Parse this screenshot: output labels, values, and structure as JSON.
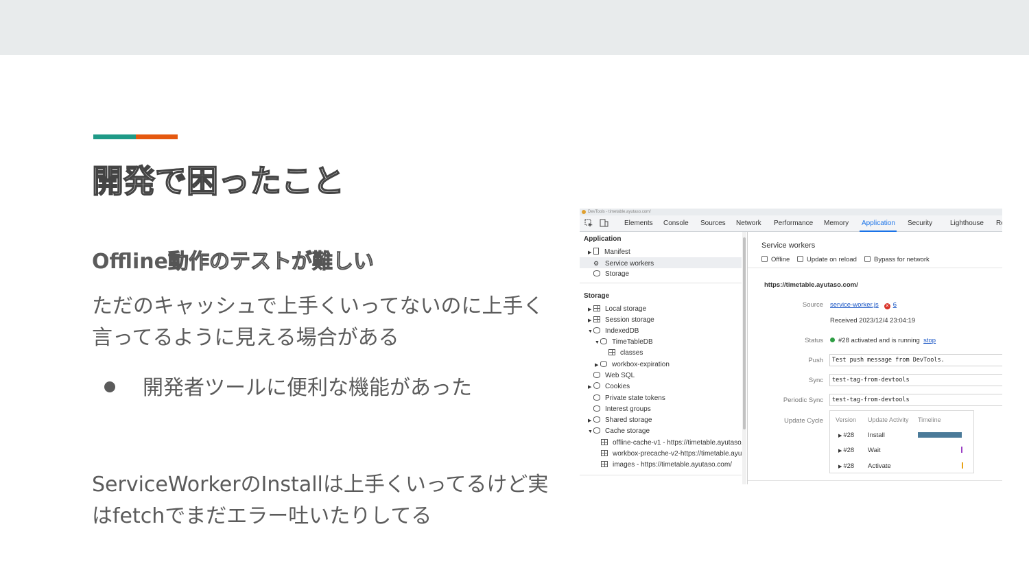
{
  "slide": {
    "title": "開発で困ったこと",
    "subheading_latin": "Offline",
    "subheading_jp": "動作のテストが難しい",
    "paragraph1": "ただのキャッシュで上手くいってないのに上手く言ってるように見える場合がある",
    "bullet": "開発者ツールに便利な機能があった",
    "paragraph2": "ServiceWorkerのInstallは上手くいってるけど実はfetchでまだエラー吐いたりしてる",
    "accent_colors": [
      "#1f9a87",
      "#e5580f"
    ]
  },
  "devtools": {
    "window_title": "DevTools - timetable.ayutaso.com/",
    "tabs": [
      "Elements",
      "Console",
      "Sources",
      "Network",
      "Performance",
      "Memory",
      "Application",
      "Security",
      "Lighthouse",
      "Re"
    ],
    "active_tab": "Application",
    "sidebar": {
      "application_header": "Application",
      "manifest": "Manifest",
      "service_workers": "Service workers",
      "storage": "Storage",
      "storage_header": "Storage",
      "local_storage": "Local storage",
      "session_storage": "Session storage",
      "indexeddb": "IndexedDB",
      "timetabledb": "TimeTableDB",
      "classes": "classes",
      "workbox_expiration": "workbox-expiration",
      "web_sql": "Web SQL",
      "cookies": "Cookies",
      "private_state_tokens": "Private state tokens",
      "interest_groups": "Interest groups",
      "shared_storage": "Shared storage",
      "cache_storage": "Cache storage",
      "cache1": "offline-cache-v1 - https://timetable.ayutaso.",
      "cache2": "workbox-precache-v2-https://timetable.ayu",
      "cache3": "images - https://timetable.ayutaso.com/"
    },
    "panel": {
      "title": "Service workers",
      "offline": "Offline",
      "update_on_reload": "Update on reload",
      "bypass_for_network": "Bypass for network",
      "origin": "https://timetable.ayutaso.com/",
      "source_label": "Source",
      "source_link": "service-worker.js",
      "error_count": "6",
      "received": "Received 2023/12/4 23:04:19",
      "status_label": "Status",
      "status_text": "#28 activated and is running",
      "stop_link": "stop",
      "push_label": "Push",
      "push_value": "Test push message from DevTools.",
      "sync_label": "Sync",
      "sync_value": "test-tag-from-devtools",
      "periodic_sync_label": "Periodic Sync",
      "periodic_sync_value": "test-tag-from-devtools",
      "update_cycle_label": "Update Cycle",
      "cycle_headers": [
        "Version",
        "Update Activity",
        "Timeline"
      ],
      "cycle_rows": [
        {
          "version": "#28",
          "activity": "Install"
        },
        {
          "version": "#28",
          "activity": "Wait"
        },
        {
          "version": "#28",
          "activity": "Activate"
        }
      ]
    }
  }
}
